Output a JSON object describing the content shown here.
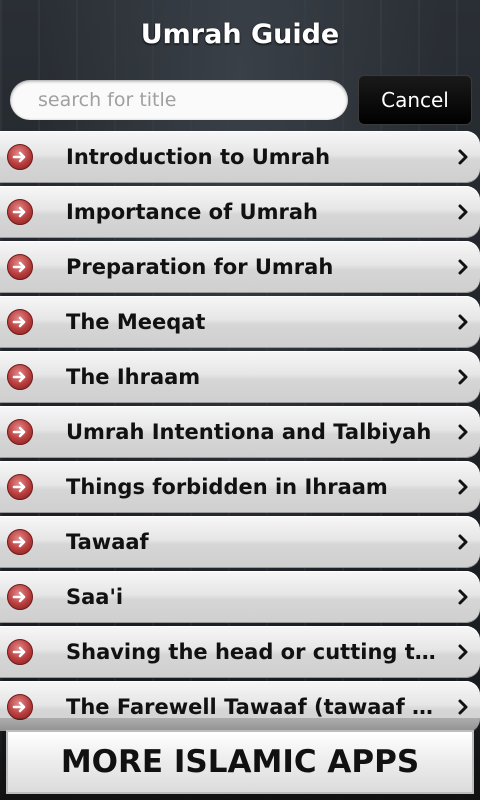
{
  "header": {
    "title": "Umrah Guide"
  },
  "search": {
    "placeholder": "search for title",
    "value": "",
    "cancel_label": "Cancel"
  },
  "list": {
    "items": [
      {
        "label": "Introduction to Umrah"
      },
      {
        "label": "Importance of Umrah"
      },
      {
        "label": "Preparation for Umrah"
      },
      {
        "label": "The Meeqat"
      },
      {
        "label": "The Ihraam"
      },
      {
        "label": "Umrah Intentiona and Talbiyah"
      },
      {
        "label": "Things forbidden in Ihraam"
      },
      {
        "label": "Tawaaf"
      },
      {
        "label": "Saa'i"
      },
      {
        "label": "Shaving the head or cutting the h…"
      },
      {
        "label": "The Farewell Tawaaf (tawaaf al-w…"
      }
    ],
    "leading_icon": "arrow-right-circle-icon",
    "trailing_icon": "chevron-right-icon"
  },
  "footer": {
    "more_apps_label": "MORE ISLAMIC APPS"
  },
  "colors": {
    "arrow_red": "#b83c3c",
    "list_bg": "#e6e6e6",
    "cancel_bg": "#000000"
  }
}
